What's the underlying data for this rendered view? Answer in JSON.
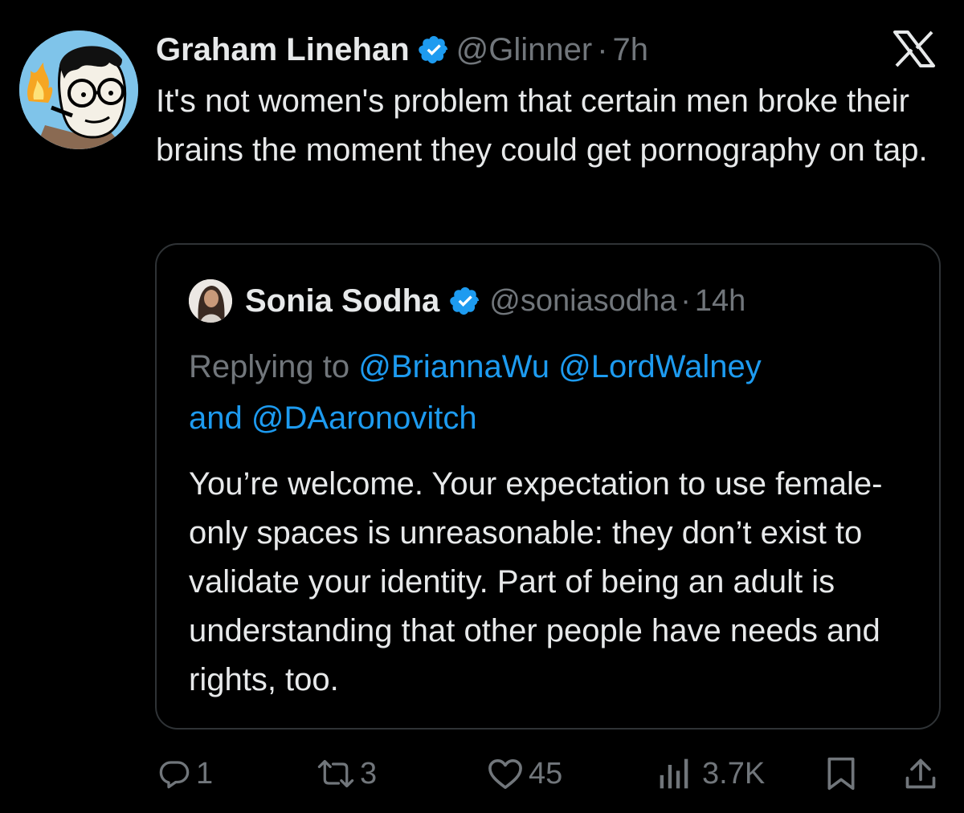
{
  "tweet": {
    "author": {
      "display_name": "Graham Linehan",
      "handle": "@Glinner",
      "avatar_icon": "cartoon-avatar-icon"
    },
    "separator": "·",
    "time": "7h",
    "text": "It's not women's problem that certain men broke their brains the moment they could get pornography on tap.",
    "platform_icon": "x-logo-icon"
  },
  "quote": {
    "author": {
      "display_name": "Sonia Sodha",
      "handle": "@soniasodha"
    },
    "separator": "·",
    "time": "14h",
    "replying_prefix": "Replying to",
    "mention_1": "@BriannaWu",
    "mention_2": "@LordWalney",
    "and_word": "and",
    "mention_3": "@DAaronovitch",
    "text": "You’re welcome. Your expectation to use female-only spaces is unreasonable: they don’t exist to validate your identity. Part of being an adult is understanding that other people have needs and rights, too."
  },
  "actions": {
    "reply_count": "1",
    "retweet_count": "3",
    "like_count": "45",
    "view_count": "3.7K"
  },
  "colors": {
    "background": "#000000",
    "text": "#e7e9ea",
    "muted": "#71767b",
    "link": "#1d9bf0",
    "border": "#2f3336",
    "verified": "#1d9bf0"
  }
}
